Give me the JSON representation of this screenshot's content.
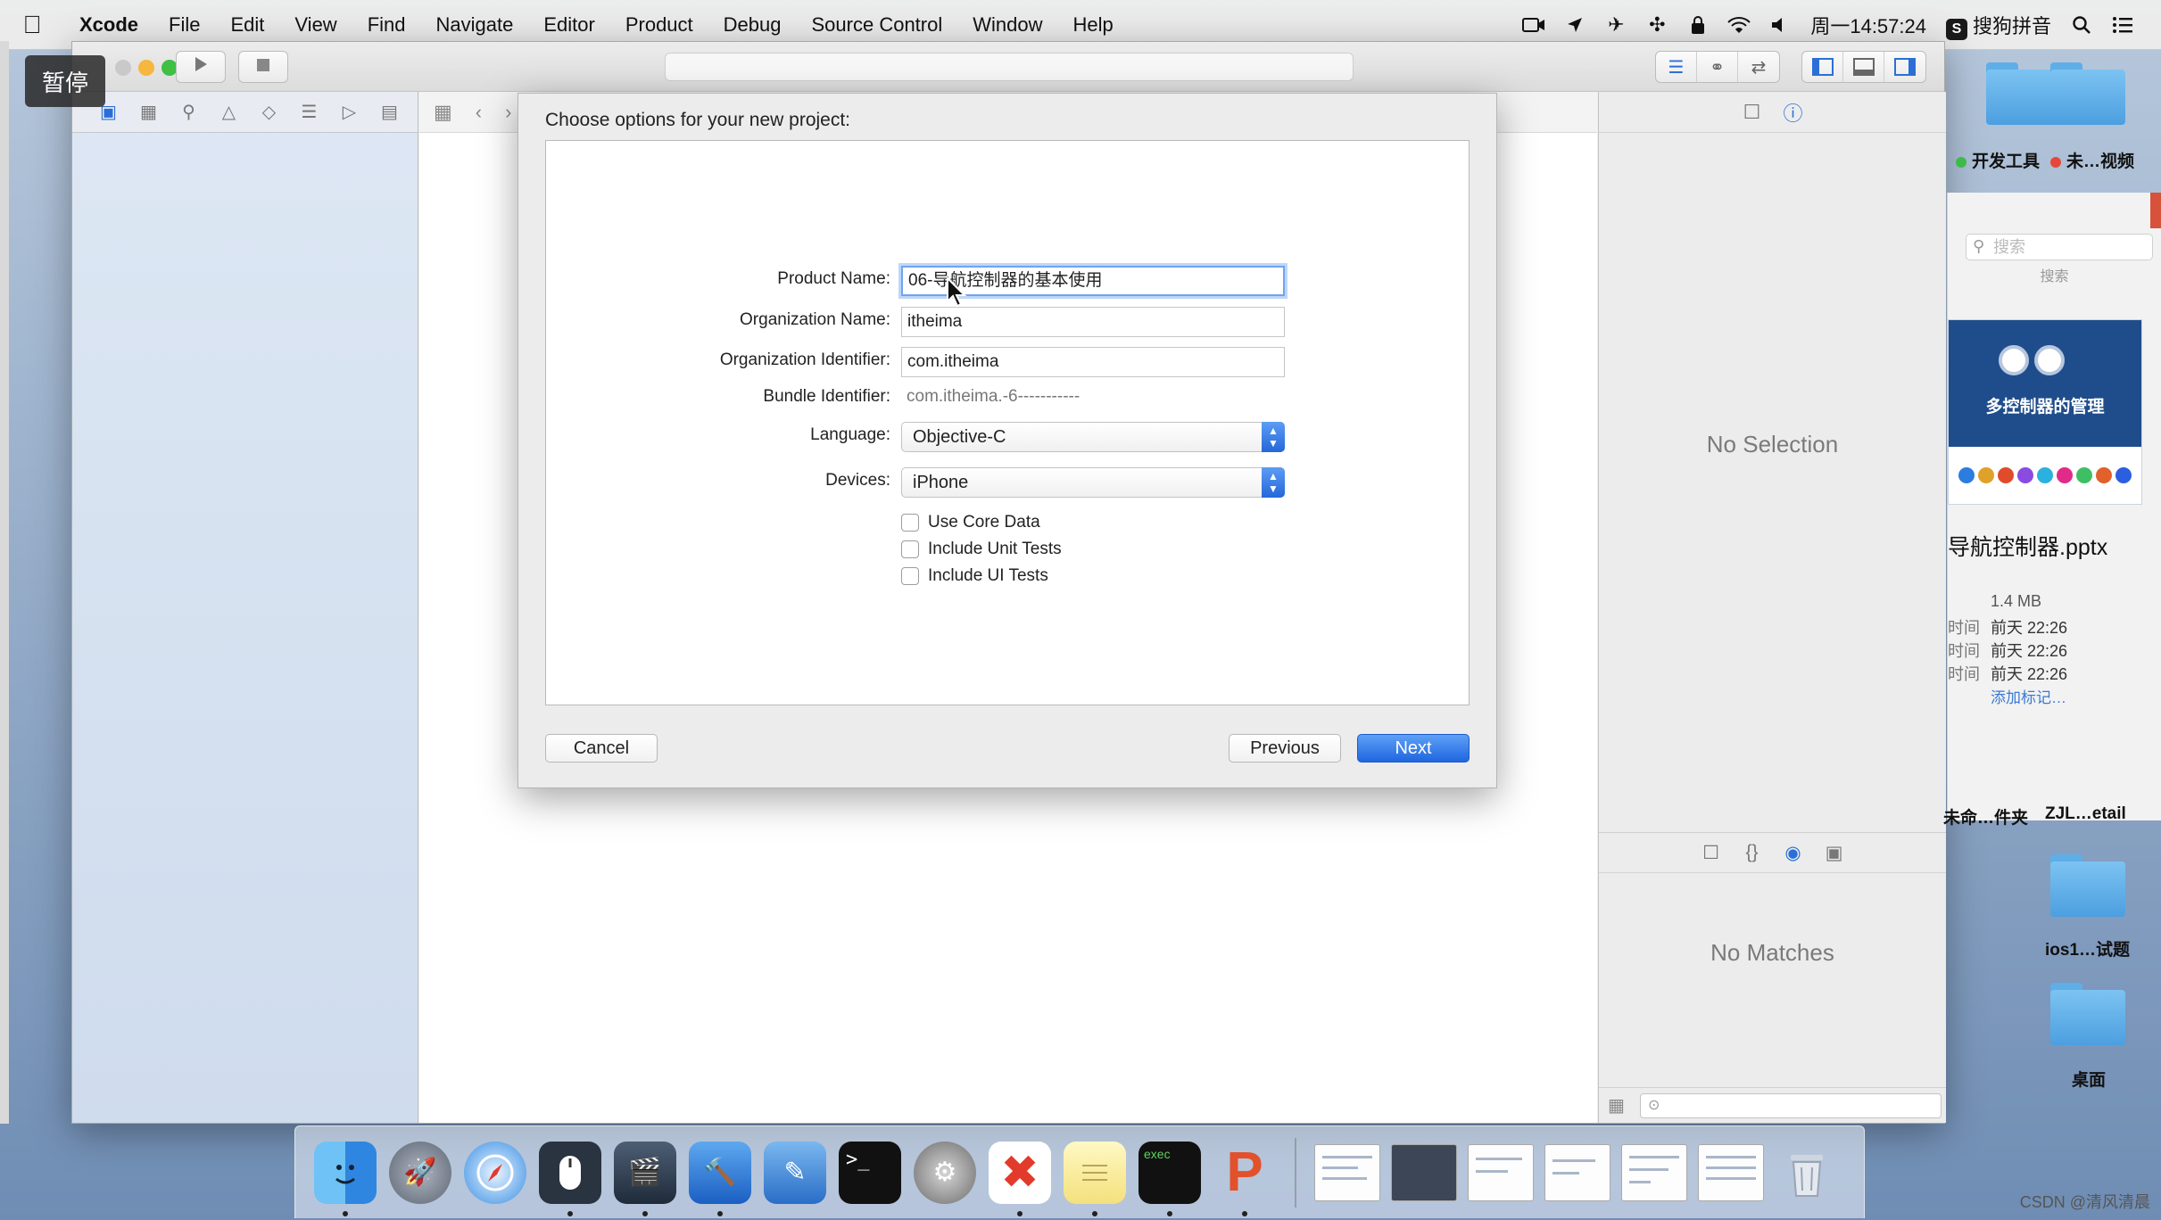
{
  "menubar": {
    "items": [
      "Xcode",
      "File",
      "Edit",
      "View",
      "Find",
      "Navigate",
      "Editor",
      "Product",
      "Debug",
      "Source Control",
      "Window",
      "Help"
    ],
    "clock": "周一14:57:24",
    "input_method": "搜狗拼音",
    "input_method_badge": "S"
  },
  "overlay": {
    "pause_label": "暂停"
  },
  "sheet": {
    "title": "Choose options for your new project:",
    "fields": {
      "product_name": {
        "label": "Product Name:",
        "value": "06-导航控制器的基本使用"
      },
      "organization_name": {
        "label": "Organization Name:",
        "value": "itheima"
      },
      "organization_identifier": {
        "label": "Organization Identifier:",
        "value": "com.itheima"
      },
      "bundle_identifier": {
        "label": "Bundle Identifier:",
        "value": "com.itheima.-6-----------"
      },
      "language": {
        "label": "Language:",
        "value": "Objective-C"
      },
      "devices": {
        "label": "Devices:",
        "value": "iPhone"
      }
    },
    "checkboxes": [
      {
        "label": "Use Core Data",
        "checked": false
      },
      {
        "label": "Include Unit Tests",
        "checked": false
      },
      {
        "label": "Include UI Tests",
        "checked": false
      }
    ],
    "buttons": {
      "cancel": "Cancel",
      "previous": "Previous",
      "next": "Next"
    }
  },
  "inspector": {
    "no_selection": "No Selection",
    "no_matches": "No Matches"
  },
  "desktop": {
    "tag_folder_1": "开发工具",
    "tag_folder_2": "未…视频",
    "search_placeholder": "搜索",
    "search_caption": "搜索",
    "ppt_title": "多控制器的管理",
    "file_name": "导航控制器.pptx",
    "file_size": "1.4 MB",
    "meta": [
      {
        "key": "时间",
        "value": "前天 22:26"
      },
      {
        "key": "时间",
        "value": "前天 22:26"
      },
      {
        "key": "时间",
        "value": "前天 22:26"
      }
    ],
    "add_tag": "添加标记…",
    "folder_label_1": "未命…件夹",
    "folder_label_2": "ZJL…etail",
    "folder_label_3": "ios1…试题",
    "folder_label_4": "桌面"
  },
  "watermark": "CSDN @清风清晨",
  "colors": {
    "accent": "#2467d9",
    "focus_ring": "#6fa4ef",
    "folder": "#4c9fe0"
  }
}
